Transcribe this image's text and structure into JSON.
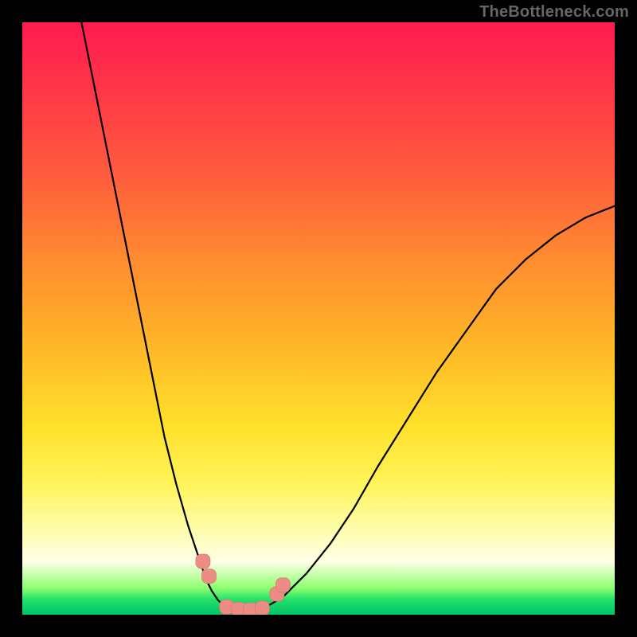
{
  "watermark": "TheBottleneck.com",
  "colors": {
    "gradient_top": "#ff1b4f",
    "gradient_mid1": "#ff8b2f",
    "gradient_mid2": "#ffe02a",
    "gradient_bottom": "#00c466",
    "curve_stroke": "#000000",
    "marker_fill": "#ec8c84",
    "frame": "#000000"
  },
  "chart_data": {
    "type": "line",
    "title": "",
    "xlabel": "",
    "ylabel": "",
    "xlim": [
      0,
      100
    ],
    "ylim": [
      0,
      100
    ],
    "grid": false,
    "series": [
      {
        "name": "left-branch",
        "x": [
          10,
          12,
          14,
          16,
          18,
          20,
          22,
          24,
          26,
          28,
          30,
          31,
          32,
          33,
          34
        ],
        "y": [
          100,
          90,
          80,
          70,
          60,
          50,
          40,
          30,
          22,
          15,
          9,
          6,
          4,
          2.5,
          1.5
        ]
      },
      {
        "name": "valley-floor",
        "x": [
          34,
          36,
          38,
          40,
          42
        ],
        "y": [
          1.5,
          0.8,
          0.6,
          0.8,
          1.8
        ]
      },
      {
        "name": "right-branch",
        "x": [
          42,
          44,
          48,
          52,
          56,
          60,
          65,
          70,
          75,
          80,
          85,
          90,
          95,
          100
        ],
        "y": [
          1.8,
          3,
          7,
          12,
          18,
          25,
          33,
          41,
          48,
          55,
          60,
          64,
          67,
          69
        ]
      }
    ],
    "markers": [
      {
        "name": "left-cluster-a",
        "x": 30.5,
        "y": 9
      },
      {
        "name": "left-cluster-b",
        "x": 31.5,
        "y": 6.5
      },
      {
        "name": "floor-a",
        "x": 34.5,
        "y": 1.3
      },
      {
        "name": "floor-b",
        "x": 36.5,
        "y": 0.9
      },
      {
        "name": "floor-c",
        "x": 38.5,
        "y": 0.8
      },
      {
        "name": "floor-d",
        "x": 40.5,
        "y": 1.1
      },
      {
        "name": "right-a",
        "x": 43.0,
        "y": 3.5
      },
      {
        "name": "right-b",
        "x": 44.0,
        "y": 5.0
      }
    ],
    "annotations": []
  }
}
